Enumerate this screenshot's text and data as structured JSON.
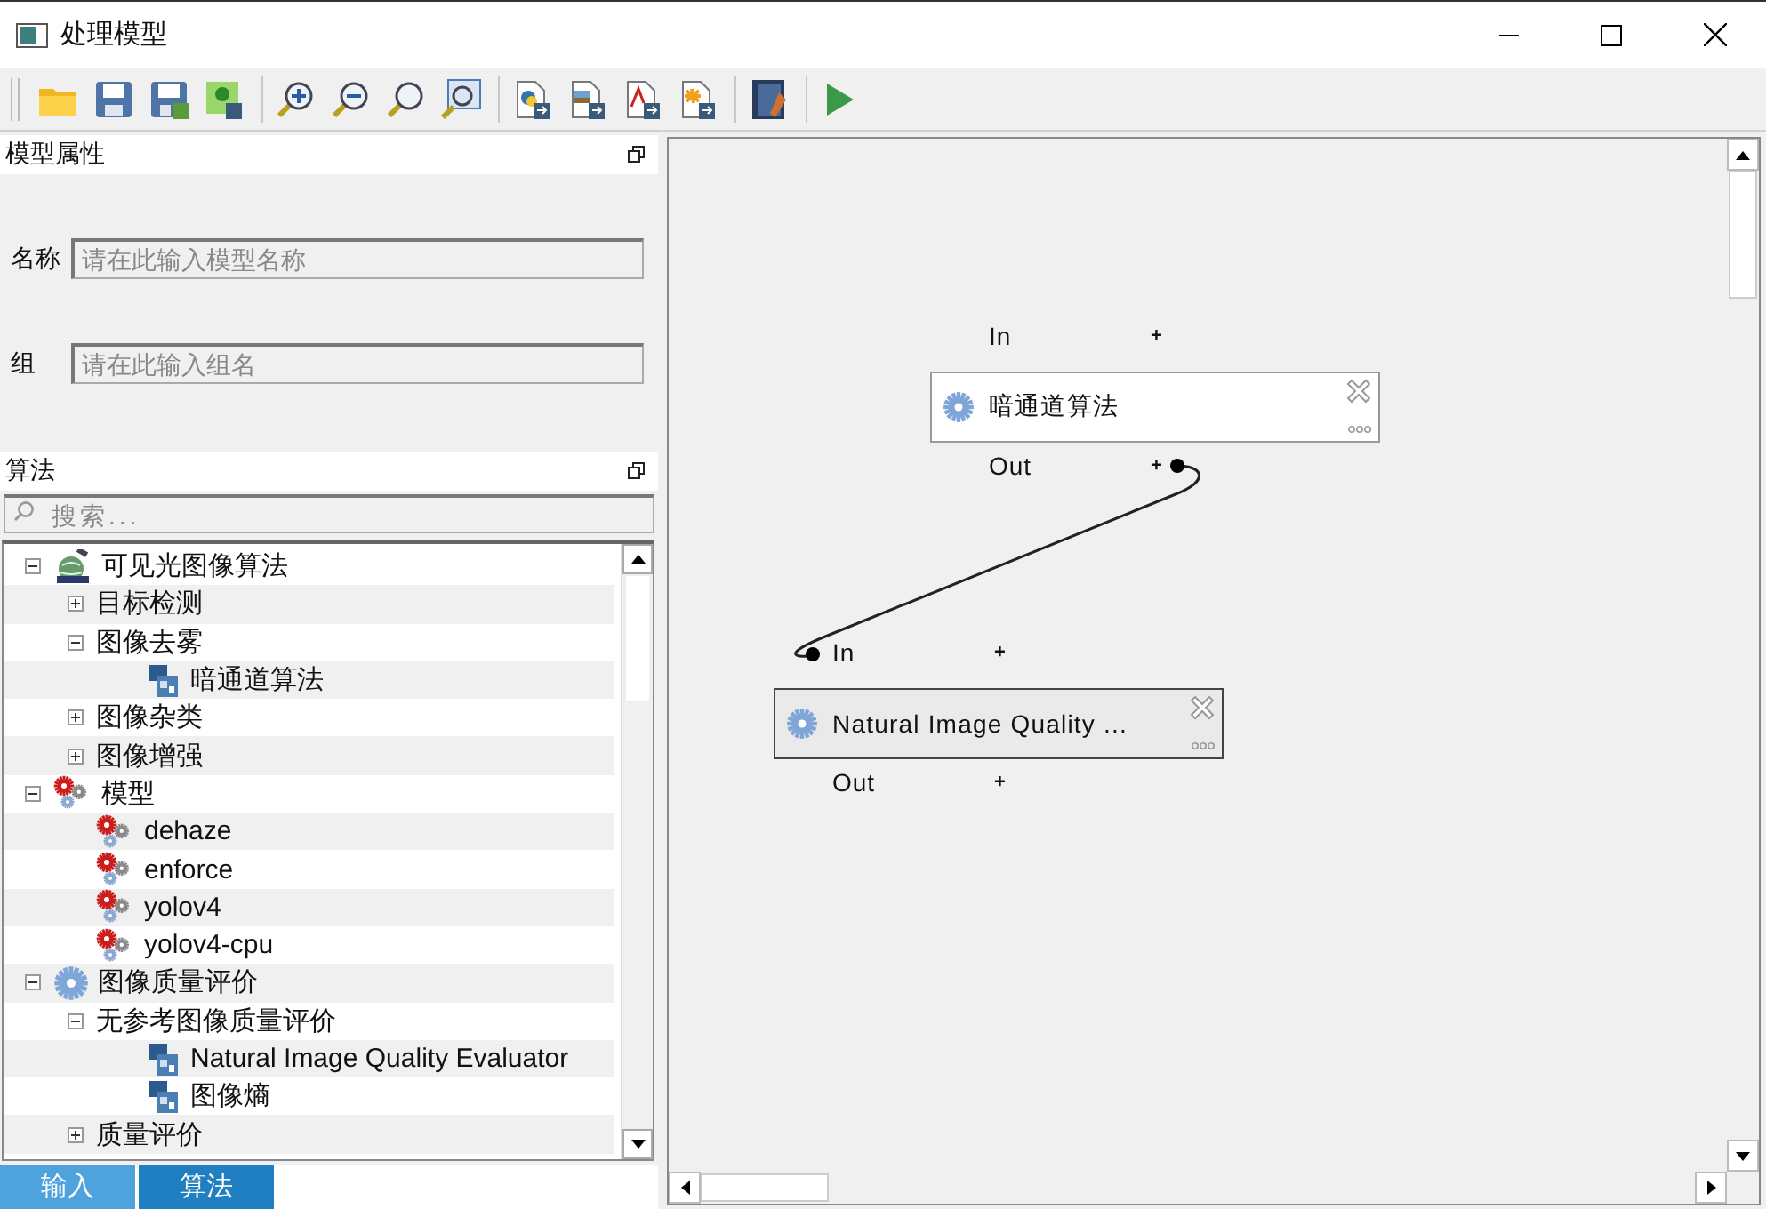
{
  "window": {
    "title": "处理模型"
  },
  "model_properties": {
    "title": "模型属性",
    "fields": [
      {
        "label": "名称",
        "placeholder": "请在此输入模型名称"
      },
      {
        "label": "组",
        "placeholder": "请在此输入组名"
      }
    ]
  },
  "algorithms": {
    "title": "算法",
    "search": {
      "placeholder": "搜索..."
    },
    "tree": [
      {
        "label": "可见光图像算法",
        "kind": "provider",
        "expanded": true,
        "children": [
          {
            "label": "目标检测",
            "kind": "group",
            "expanded": false
          },
          {
            "label": "图像去雾",
            "kind": "group",
            "expanded": true,
            "children": [
              {
                "label": "暗通道算法",
                "kind": "algorithm"
              }
            ]
          },
          {
            "label": "图像杂类",
            "kind": "group",
            "expanded": false
          },
          {
            "label": "图像增强",
            "kind": "group",
            "expanded": false
          }
        ]
      },
      {
        "label": "模型",
        "kind": "models",
        "expanded": true,
        "children": [
          {
            "label": "dehaze",
            "kind": "model"
          },
          {
            "label": "enforce",
            "kind": "model"
          },
          {
            "label": "yolov4",
            "kind": "model"
          },
          {
            "label": "yolov4-cpu",
            "kind": "model"
          }
        ]
      },
      {
        "label": "图像质量评价",
        "kind": "quality",
        "expanded": true,
        "children": [
          {
            "label": "无参考图像质量评价",
            "kind": "group",
            "expanded": true,
            "children": [
              {
                "label": "Natural Image Quality Evaluator",
                "kind": "algorithm"
              },
              {
                "label": "图像熵",
                "kind": "algorithm"
              }
            ]
          },
          {
            "label": "质量评价",
            "kind": "group",
            "expanded": false
          }
        ]
      }
    ]
  },
  "bottom_tabs": [
    {
      "label": "输入",
      "selected": false
    },
    {
      "label": "算法",
      "selected": true
    }
  ],
  "canvas": {
    "nodes": [
      {
        "title": "暗通道算法",
        "input": "In",
        "output": "Out",
        "add_input": "+",
        "add_output": "+",
        "selected": false
      },
      {
        "title": "Natural Image Quality ...",
        "input": "In",
        "output": "Out",
        "add_input": "+",
        "add_output": "+",
        "selected": true
      }
    ]
  }
}
